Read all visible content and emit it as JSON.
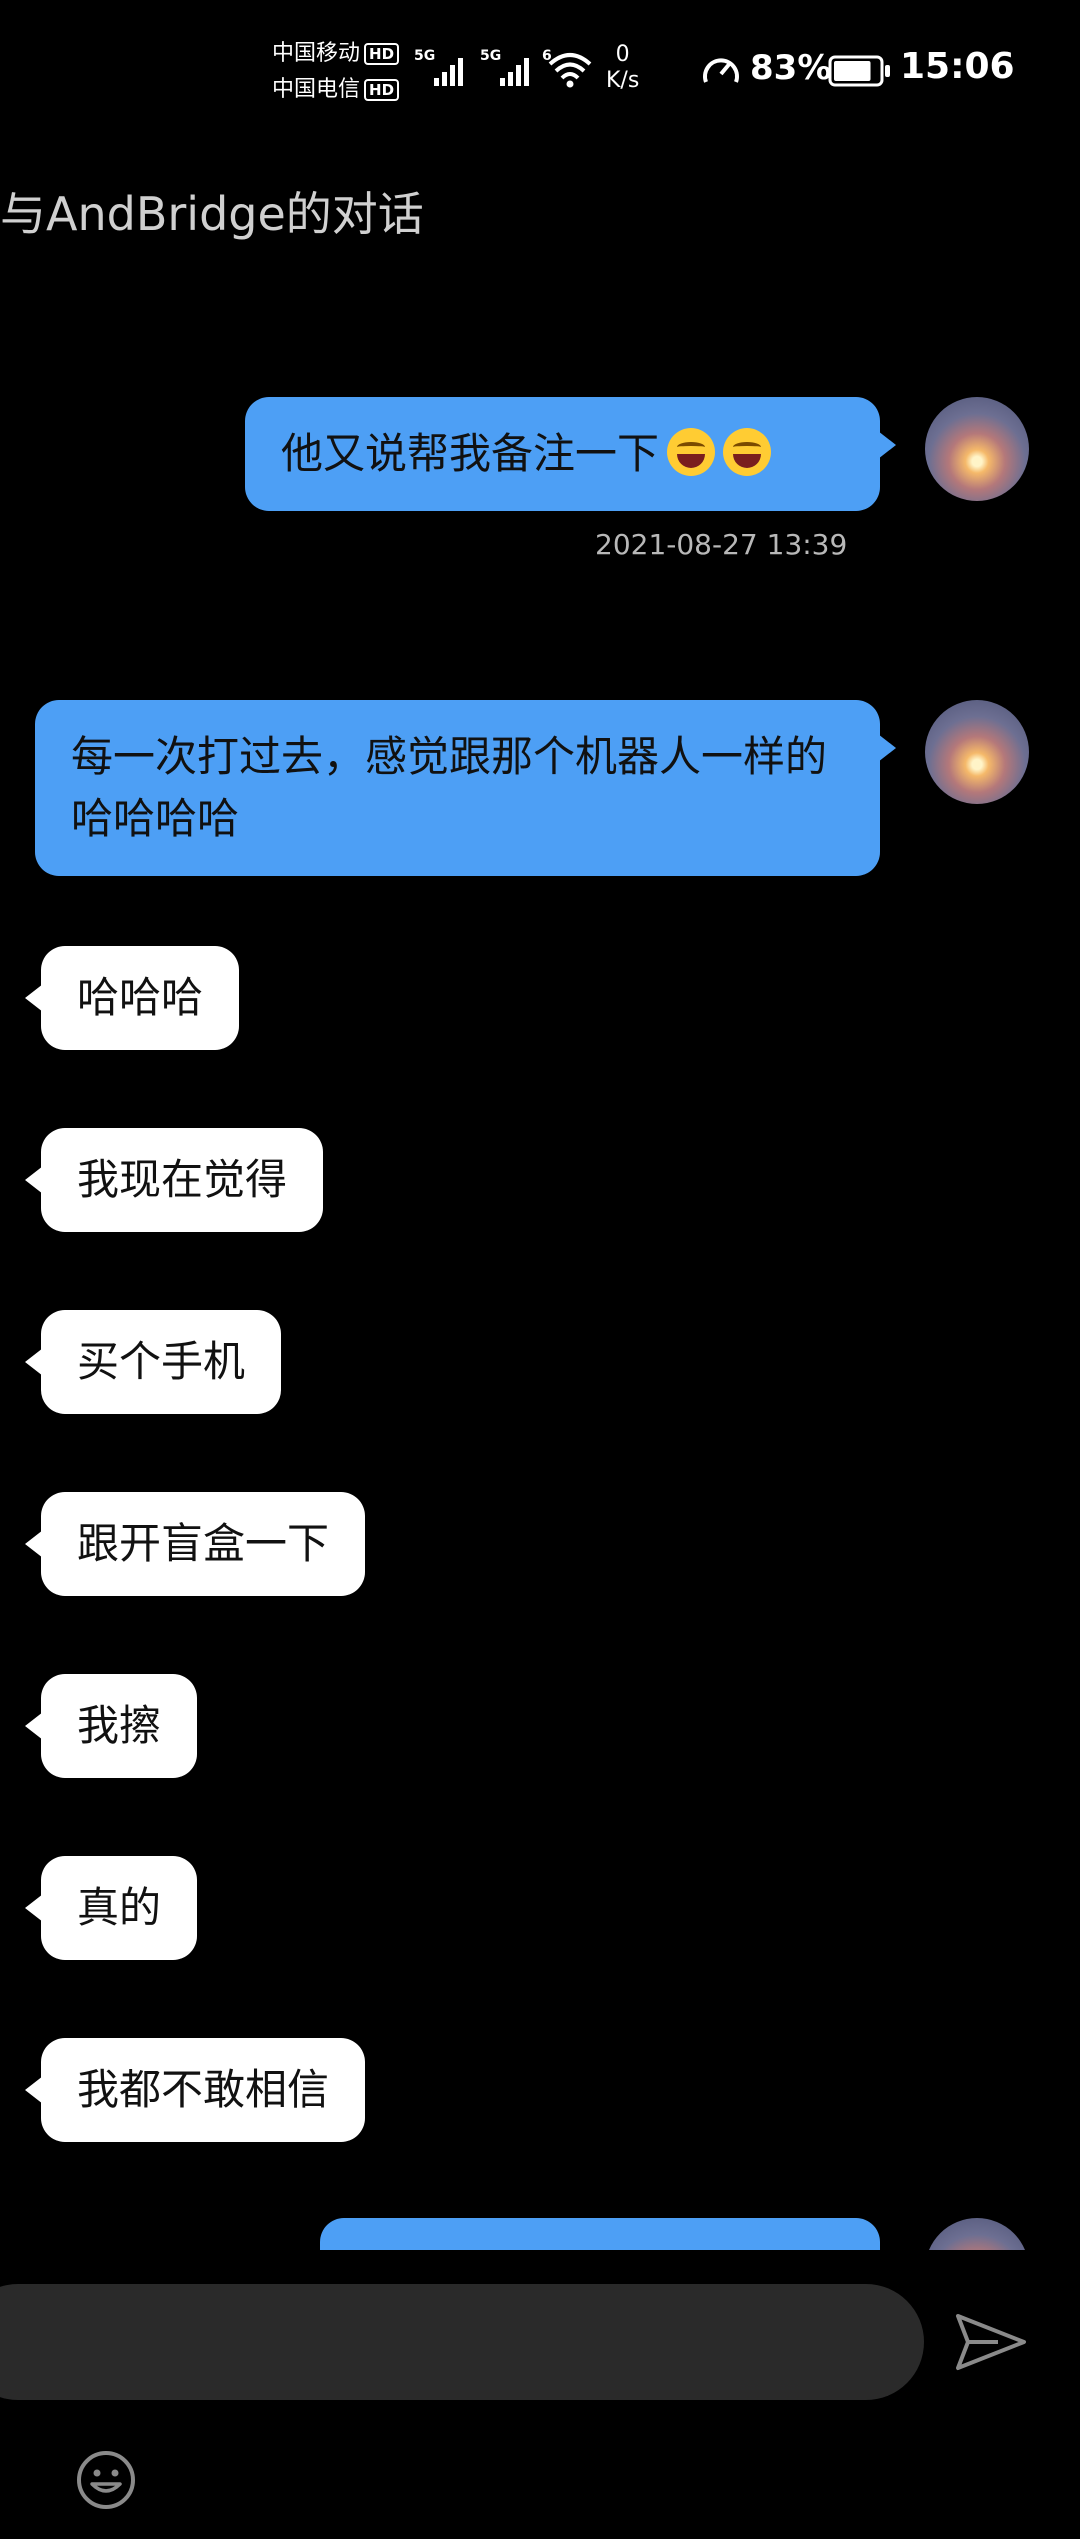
{
  "status_bar": {
    "carrier1": "中国移动",
    "carrier2": "中国电信",
    "hd_label": "HD",
    "net_type1": "5G",
    "net_type2": "5G",
    "net_type3": "6",
    "net_speed_value": "0",
    "net_speed_unit": "K/s",
    "battery_pct": "83%",
    "battery_level": 0.83,
    "time": "15:06"
  },
  "header": {
    "title": "与AndBridge的对话"
  },
  "messages": [
    {
      "side": "me",
      "text": "他又说帮我备注一下",
      "emoji": [
        "laughing-tears-emoji",
        "laughing-tears-emoji"
      ],
      "timestamp": "2021-08-27 13:39"
    },
    {
      "side": "me",
      "text": "每一次打过去，感觉跟那个机器人一样的哈哈哈哈"
    },
    {
      "side": "them",
      "text": "哈哈哈"
    },
    {
      "side": "them",
      "text": "我现在觉得"
    },
    {
      "side": "them",
      "text": "买个手机"
    },
    {
      "side": "them",
      "text": "跟开盲盒一下"
    },
    {
      "side": "them",
      "text": "我擦"
    },
    {
      "side": "them",
      "text": "真的"
    },
    {
      "side": "them",
      "text": "我都不敢相信"
    },
    {
      "side": "me",
      "text": ""
    }
  ],
  "input": {
    "placeholder": ""
  },
  "icons": {
    "send": "send-icon",
    "emoji": "emoji-icon",
    "avatar": "sunset-avatar"
  },
  "colors": {
    "my_bubble": "#4d9ff5",
    "their_bubble": "#ffffff",
    "background": "#000000",
    "input_bg": "#2a2a2a"
  }
}
